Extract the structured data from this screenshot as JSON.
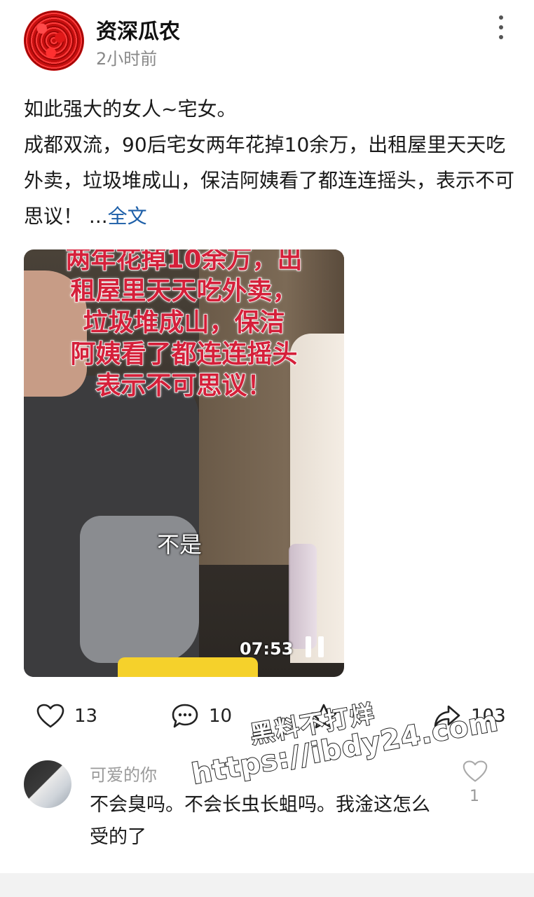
{
  "post": {
    "author": "资深瓜农",
    "time": "2小时前",
    "title_line": "如此强大的女人~宅女。",
    "body": "成都双流，90后宅女两年花掉10余万，出租屋里天天吃外卖，垃圾堆成山，保洁阿姨看了都连连摇头，表示不可思议！",
    "ellipsis": "...",
    "more_label": "全文"
  },
  "video": {
    "caption_lines": [
      "两年花掉10余万，出",
      "租屋里天天吃外卖，",
      "垃圾堆成山，保洁",
      "阿姨看了都连连摇头",
      "表示不可思议！"
    ],
    "subtitle": "不是",
    "duration": "07:53"
  },
  "actions": {
    "likes": "13",
    "comments": "10",
    "shares": "103"
  },
  "watermark": {
    "line1": "黑料不打烊",
    "line2": "https://ibdy24.com"
  },
  "comment": {
    "user": "可爱的你",
    "text": "不会臭吗。不会长虫长蛆吗。我淦这怎么受的了",
    "likes": "1"
  },
  "icons": [
    "more-icon",
    "heart-icon",
    "comment-icon",
    "star-icon",
    "share-icon",
    "pause-icon"
  ]
}
